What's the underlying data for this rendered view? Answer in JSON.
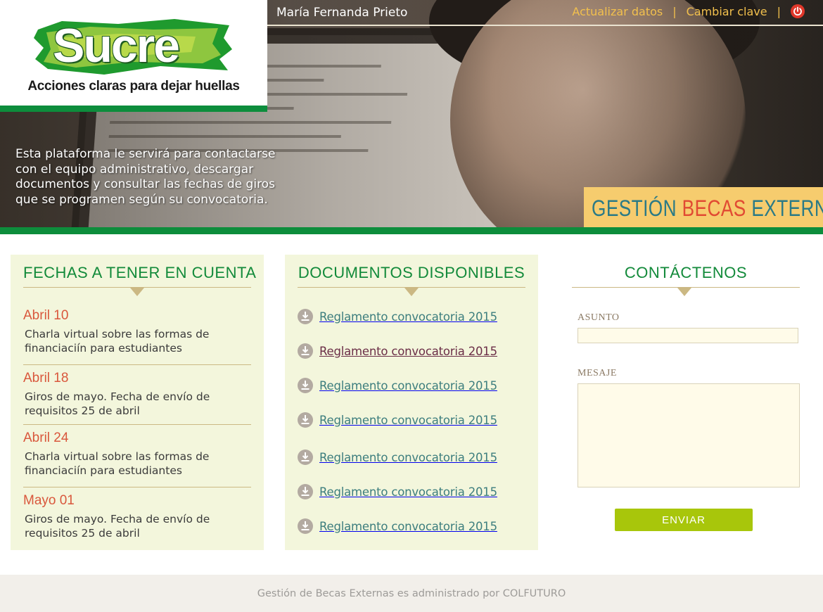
{
  "header": {
    "logo_word": "Sucre",
    "logo_tagline": "Acciones claras para dejar huellas",
    "user_name": "María Fernanda Prieto",
    "nav": {
      "update_label": "Actualizar datos",
      "change_password_label": "Cambiar clave",
      "separator": "|"
    },
    "intro_text": "Esta plataforma le servirá para contactarse con el equipo administrativo, descargar documentos y consultar las fechas de giros que se programen según su convocatoria.",
    "brand": {
      "part1": "GESTIÓN",
      "part2": "BECAS",
      "part3": "EXTERNAS"
    }
  },
  "fechas": {
    "title": "FECHAS A TENER EN CUENTA",
    "items": [
      {
        "date": "Abril 10",
        "desc": "Charla virtual sobre las formas de financiaciín para estudiantes"
      },
      {
        "date": "Abril 18",
        "desc": "Giros de mayo. Fecha de envío de requisitos 25 de abril"
      },
      {
        "date": "Abril 24",
        "desc": "Charla virtual sobre las formas de financiaciín para estudiantes"
      },
      {
        "date": "Mayo 01",
        "desc": "Giros de mayo. Fecha de envío de requisitos 25 de abril"
      }
    ]
  },
  "documentos": {
    "title": "DOCUMENTOS DISPONIBLES",
    "items": [
      {
        "label": "Reglamento convocatoria 2015"
      },
      {
        "label": "Reglamento convocatoria 2015"
      },
      {
        "label": "Reglamento convocatoria 2015"
      },
      {
        "label": "Reglamento convocatoria 2015"
      },
      {
        "label": "Reglamento convocatoria 2015"
      },
      {
        "label": "Reglamento convocatoria 2015"
      },
      {
        "label": "Reglamento convocatoria 2015"
      }
    ]
  },
  "contacto": {
    "title": "CONTÁCTENOS",
    "asunto_label": "Asunto",
    "mensaje_label": "Mesaje",
    "asunto_value": "",
    "mensaje_value": "",
    "send_label": "ENVIAR"
  },
  "footer": {
    "text": "Gestión de Becas Externas es administrado por COLFUTURO"
  },
  "colors": {
    "green": "#0d8d3c",
    "accent_orange": "#d9573c",
    "brand_yellow": "#f6cc6e",
    "button_green": "#a8c60b",
    "link_teal": "#3d7e7e"
  }
}
